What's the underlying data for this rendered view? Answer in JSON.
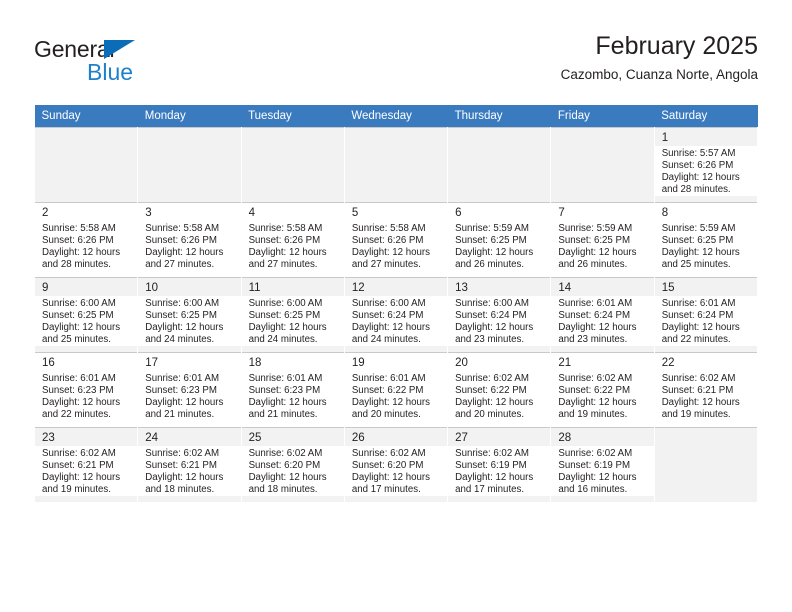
{
  "logo": {
    "word1": "General",
    "word2": "Blue",
    "triangle_color": "#0b6cb7",
    "blue_color": "#2081cb"
  },
  "header": {
    "month_title": "February 2025",
    "location": "Cazombo, Cuanza Norte, Angola"
  },
  "theme": {
    "header_bg": "#3a7bbf",
    "header_text": "#ffffff",
    "row_shade": "#f2f2f2",
    "grid_line": "#c9c9c9"
  },
  "weekdays": [
    "Sunday",
    "Monday",
    "Tuesday",
    "Wednesday",
    "Thursday",
    "Friday",
    "Saturday"
  ],
  "labels": {
    "sunrise_prefix": "Sunrise: ",
    "sunset_prefix": "Sunset: ",
    "daylight_prefix": "Daylight: "
  },
  "weeks": [
    [
      {
        "day": "",
        "empty": true
      },
      {
        "day": "",
        "empty": true
      },
      {
        "day": "",
        "empty": true
      },
      {
        "day": "",
        "empty": true
      },
      {
        "day": "",
        "empty": true
      },
      {
        "day": "",
        "empty": true
      },
      {
        "day": "1",
        "sunrise": "Sunrise: 5:57 AM",
        "sunset": "Sunset: 6:26 PM",
        "daylight": "Daylight: 12 hours and 28 minutes."
      }
    ],
    [
      {
        "day": "2",
        "sunrise": "Sunrise: 5:58 AM",
        "sunset": "Sunset: 6:26 PM",
        "daylight": "Daylight: 12 hours and 28 minutes."
      },
      {
        "day": "3",
        "sunrise": "Sunrise: 5:58 AM",
        "sunset": "Sunset: 6:26 PM",
        "daylight": "Daylight: 12 hours and 27 minutes."
      },
      {
        "day": "4",
        "sunrise": "Sunrise: 5:58 AM",
        "sunset": "Sunset: 6:26 PM",
        "daylight": "Daylight: 12 hours and 27 minutes."
      },
      {
        "day": "5",
        "sunrise": "Sunrise: 5:58 AM",
        "sunset": "Sunset: 6:26 PM",
        "daylight": "Daylight: 12 hours and 27 minutes."
      },
      {
        "day": "6",
        "sunrise": "Sunrise: 5:59 AM",
        "sunset": "Sunset: 6:25 PM",
        "daylight": "Daylight: 12 hours and 26 minutes."
      },
      {
        "day": "7",
        "sunrise": "Sunrise: 5:59 AM",
        "sunset": "Sunset: 6:25 PM",
        "daylight": "Daylight: 12 hours and 26 minutes."
      },
      {
        "day": "8",
        "sunrise": "Sunrise: 5:59 AM",
        "sunset": "Sunset: 6:25 PM",
        "daylight": "Daylight: 12 hours and 25 minutes."
      }
    ],
    [
      {
        "day": "9",
        "sunrise": "Sunrise: 6:00 AM",
        "sunset": "Sunset: 6:25 PM",
        "daylight": "Daylight: 12 hours and 25 minutes."
      },
      {
        "day": "10",
        "sunrise": "Sunrise: 6:00 AM",
        "sunset": "Sunset: 6:25 PM",
        "daylight": "Daylight: 12 hours and 24 minutes."
      },
      {
        "day": "11",
        "sunrise": "Sunrise: 6:00 AM",
        "sunset": "Sunset: 6:25 PM",
        "daylight": "Daylight: 12 hours and 24 minutes."
      },
      {
        "day": "12",
        "sunrise": "Sunrise: 6:00 AM",
        "sunset": "Sunset: 6:24 PM",
        "daylight": "Daylight: 12 hours and 24 minutes."
      },
      {
        "day": "13",
        "sunrise": "Sunrise: 6:00 AM",
        "sunset": "Sunset: 6:24 PM",
        "daylight": "Daylight: 12 hours and 23 minutes."
      },
      {
        "day": "14",
        "sunrise": "Sunrise: 6:01 AM",
        "sunset": "Sunset: 6:24 PM",
        "daylight": "Daylight: 12 hours and 23 minutes."
      },
      {
        "day": "15",
        "sunrise": "Sunrise: 6:01 AM",
        "sunset": "Sunset: 6:24 PM",
        "daylight": "Daylight: 12 hours and 22 minutes."
      }
    ],
    [
      {
        "day": "16",
        "sunrise": "Sunrise: 6:01 AM",
        "sunset": "Sunset: 6:23 PM",
        "daylight": "Daylight: 12 hours and 22 minutes."
      },
      {
        "day": "17",
        "sunrise": "Sunrise: 6:01 AM",
        "sunset": "Sunset: 6:23 PM",
        "daylight": "Daylight: 12 hours and 21 minutes."
      },
      {
        "day": "18",
        "sunrise": "Sunrise: 6:01 AM",
        "sunset": "Sunset: 6:23 PM",
        "daylight": "Daylight: 12 hours and 21 minutes."
      },
      {
        "day": "19",
        "sunrise": "Sunrise: 6:01 AM",
        "sunset": "Sunset: 6:22 PM",
        "daylight": "Daylight: 12 hours and 20 minutes."
      },
      {
        "day": "20",
        "sunrise": "Sunrise: 6:02 AM",
        "sunset": "Sunset: 6:22 PM",
        "daylight": "Daylight: 12 hours and 20 minutes."
      },
      {
        "day": "21",
        "sunrise": "Sunrise: 6:02 AM",
        "sunset": "Sunset: 6:22 PM",
        "daylight": "Daylight: 12 hours and 19 minutes."
      },
      {
        "day": "22",
        "sunrise": "Sunrise: 6:02 AM",
        "sunset": "Sunset: 6:21 PM",
        "daylight": "Daylight: 12 hours and 19 minutes."
      }
    ],
    [
      {
        "day": "23",
        "sunrise": "Sunrise: 6:02 AM",
        "sunset": "Sunset: 6:21 PM",
        "daylight": "Daylight: 12 hours and 19 minutes."
      },
      {
        "day": "24",
        "sunrise": "Sunrise: 6:02 AM",
        "sunset": "Sunset: 6:21 PM",
        "daylight": "Daylight: 12 hours and 18 minutes."
      },
      {
        "day": "25",
        "sunrise": "Sunrise: 6:02 AM",
        "sunset": "Sunset: 6:20 PM",
        "daylight": "Daylight: 12 hours and 18 minutes."
      },
      {
        "day": "26",
        "sunrise": "Sunrise: 6:02 AM",
        "sunset": "Sunset: 6:20 PM",
        "daylight": "Daylight: 12 hours and 17 minutes."
      },
      {
        "day": "27",
        "sunrise": "Sunrise: 6:02 AM",
        "sunset": "Sunset: 6:19 PM",
        "daylight": "Daylight: 12 hours and 17 minutes."
      },
      {
        "day": "28",
        "sunrise": "Sunrise: 6:02 AM",
        "sunset": "Sunset: 6:19 PM",
        "daylight": "Daylight: 12 hours and 16 minutes."
      },
      {
        "day": "",
        "empty": true
      }
    ]
  ]
}
